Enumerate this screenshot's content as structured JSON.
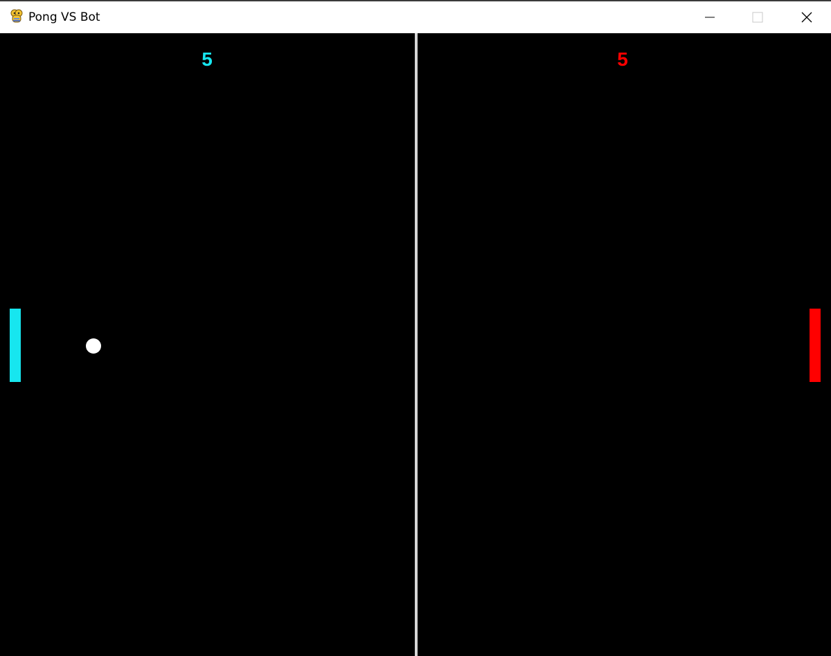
{
  "window": {
    "title": "Pong VS Bot",
    "app_icon": "pygame-snake-icon",
    "controls": {
      "minimize_icon": "minimize-icon",
      "maximize_icon": "maximize-icon",
      "close_icon": "close-icon"
    }
  },
  "game": {
    "background_color": "#000000",
    "divider_color": "#d6d6d6",
    "player": {
      "score": "5",
      "color": "#17e6ef"
    },
    "bot": {
      "score": "5",
      "color": "#ff0000"
    },
    "ball": {
      "color": "#ffffff"
    }
  }
}
